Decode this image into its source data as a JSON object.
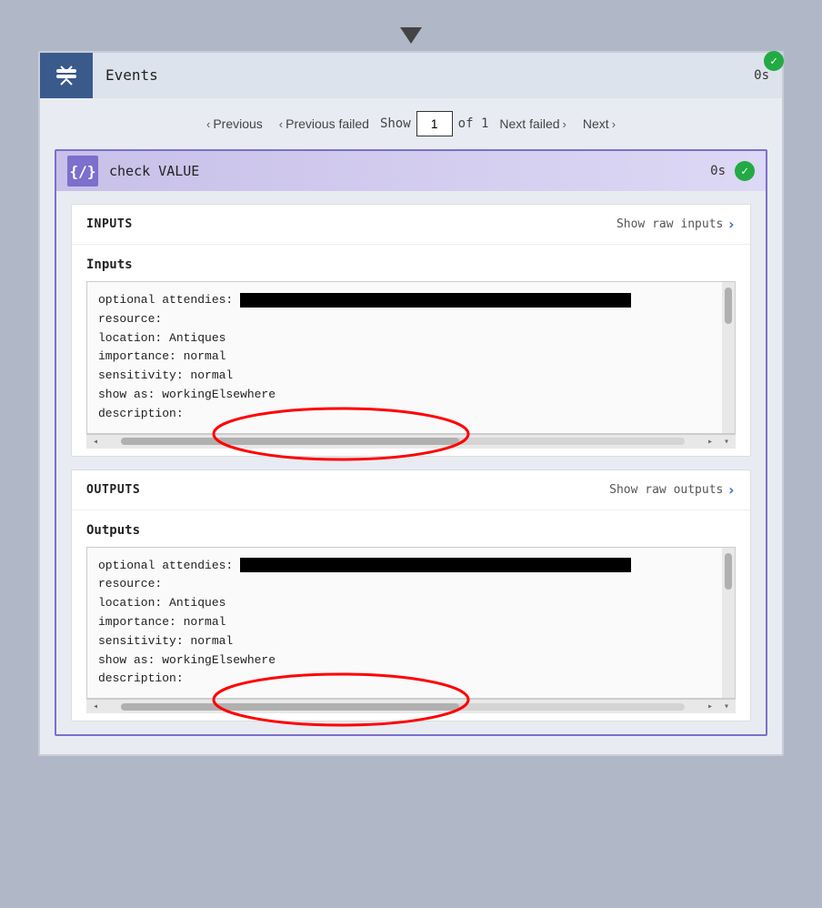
{
  "arrow": "↓",
  "header": {
    "icon_symbol": "⇄",
    "title": "Events",
    "timer": "0s"
  },
  "nav": {
    "previous_label": "Previous",
    "previous_failed_label": "Previous failed",
    "show_label": "Show",
    "show_value": "1",
    "of_label": "of 1",
    "next_failed_label": "Next failed",
    "next_label": "Next"
  },
  "step": {
    "icon": "{/}",
    "title": "check VALUE",
    "timer": "0s"
  },
  "inputs_panel": {
    "header_title": "INPUTS",
    "header_link": "Show raw inputs",
    "subtitle": "Inputs",
    "lines": [
      "optional attendies:",
      "resource:",
      "location: Antiques",
      "importance: normal",
      "sensitivity: normal",
      "show as: workingElsewhere",
      "description:"
    ]
  },
  "outputs_panel": {
    "header_title": "OUTPUTS",
    "header_link": "Show raw outputs",
    "subtitle": "Outputs",
    "lines": [
      "optional attendies:",
      "resource:",
      "location: Antiques",
      "importance: normal",
      "sensitivity: normal",
      "show as: workingElsewhere",
      "description:"
    ]
  }
}
